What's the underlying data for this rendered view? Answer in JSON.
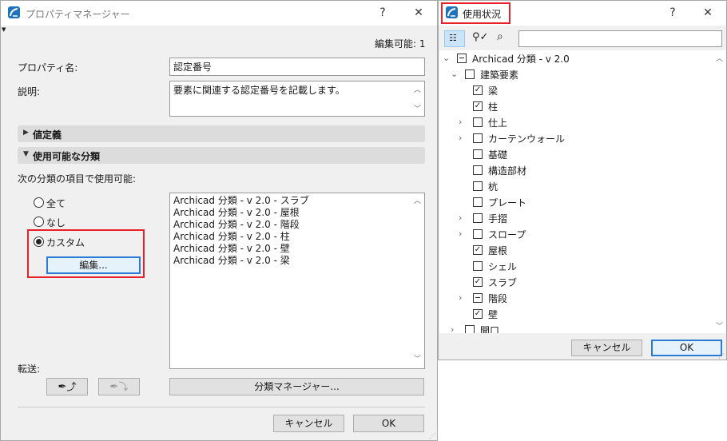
{
  "left_dialog": {
    "title": "プロパティマネージャー",
    "help": "?",
    "close": "✕",
    "editable_count": "編集可能: 1",
    "property_name_label": "プロパティ名:",
    "property_name_value": "認定番号",
    "description_label": "説明:",
    "description_value": "要素に関連する認定番号を記載します。",
    "section_value_definition": "値定義",
    "section_classification": "使用可能な分類",
    "available_label": "次の分類の項目で使用可能:",
    "radio_all": "全て",
    "radio_none": "なし",
    "radio_custom": "カスタム",
    "edit_button": "編集...",
    "classification_list": [
      "Archicad 分類 - v 2.0 - スラブ",
      "Archicad 分類 - v 2.0 - 屋根",
      "Archicad 分類 - v 2.0 - 階段",
      "Archicad 分類 - v 2.0 - 柱",
      "Archicad 分類 - v 2.0 - 壁",
      "Archicad 分類 - v 2.0 - 梁"
    ],
    "transfer_label": "転送:",
    "classification_manager_button": "分類マネージャー...",
    "cancel_button": "キャンセル",
    "ok_button": "OK"
  },
  "right_dialog": {
    "title": "使用状況",
    "help": "?",
    "close": "✕",
    "search_placeholder": "",
    "tree": [
      {
        "label": "Archicad 分類 - v 2.0",
        "state": "partial",
        "chevron": "down",
        "level": 0
      },
      {
        "label": "建築要素",
        "state": "unchecked",
        "chevron": "down",
        "level": 1
      },
      {
        "label": "梁",
        "state": "checked",
        "chevron": "",
        "level": 2
      },
      {
        "label": "柱",
        "state": "checked",
        "chevron": "",
        "level": 2
      },
      {
        "label": "仕上",
        "state": "unchecked",
        "chevron": "right",
        "level": 2
      },
      {
        "label": "カーテンウォール",
        "state": "unchecked",
        "chevron": "right",
        "level": 2
      },
      {
        "label": "基礎",
        "state": "unchecked",
        "chevron": "",
        "level": 2
      },
      {
        "label": "構造部材",
        "state": "unchecked",
        "chevron": "",
        "level": 2
      },
      {
        "label": "杭",
        "state": "unchecked",
        "chevron": "",
        "level": 2
      },
      {
        "label": "プレート",
        "state": "unchecked",
        "chevron": "",
        "level": 2
      },
      {
        "label": "手摺",
        "state": "unchecked",
        "chevron": "right",
        "level": 2
      },
      {
        "label": "スロープ",
        "state": "unchecked",
        "chevron": "right",
        "level": 2
      },
      {
        "label": "屋根",
        "state": "checked",
        "chevron": "",
        "level": 2
      },
      {
        "label": "シェル",
        "state": "unchecked",
        "chevron": "",
        "level": 2
      },
      {
        "label": "スラブ",
        "state": "checked",
        "chevron": "",
        "level": 2
      },
      {
        "label": "階段",
        "state": "partial",
        "chevron": "right",
        "level": 2
      },
      {
        "label": "壁",
        "state": "checked",
        "chevron": "",
        "level": 2
      },
      {
        "label": "開口",
        "state": "unchecked",
        "chevron": "right",
        "level": 1
      }
    ],
    "cancel_button": "キャンセル",
    "ok_button": "OK"
  },
  "colors": {
    "highlight_red": "#e8202a",
    "accent_blue": "#2a7bd3",
    "logo_blue": "#1e73be"
  }
}
